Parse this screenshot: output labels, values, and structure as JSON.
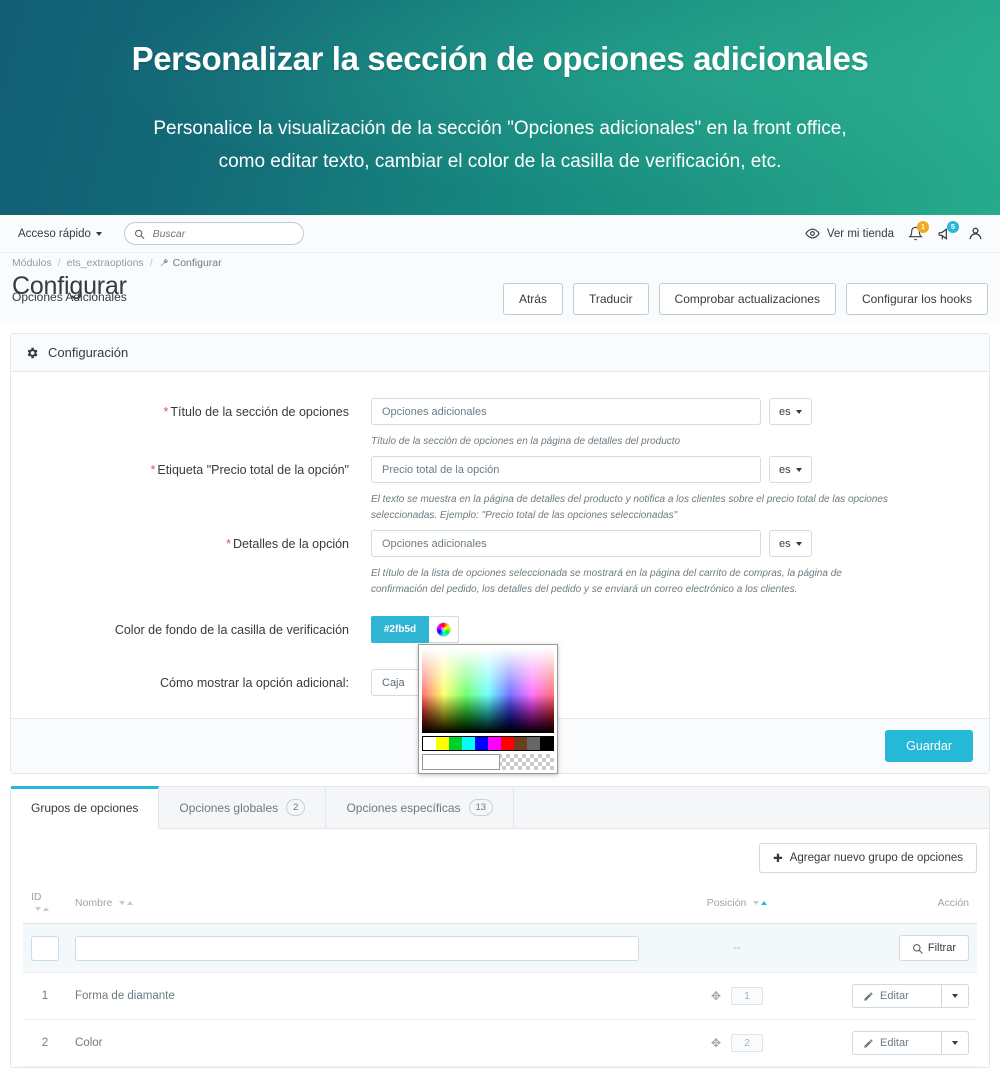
{
  "hero": {
    "title": "Personalizar la sección de opciones adicionales",
    "subtitle_line1": "Personalice la visualización de la sección \"Opciones adicionales\" en la front office,",
    "subtitle_line2": "como editar texto, cambiar el color de la casilla de verificación, etc."
  },
  "topbar": {
    "quick_access": "Acceso rápido",
    "search_placeholder": "Buscar",
    "search_value": "",
    "view_shop": "Ver mi tienda",
    "notifications_badge": "1",
    "announcements_badge": "5"
  },
  "breadcrumb": {
    "item1": "Módulos",
    "sep": "/",
    "item2": "ets_extraoptions",
    "current": "Configurar"
  },
  "page": {
    "title": "Configurar",
    "subtitle": "Opciones Adicionales"
  },
  "head_actions": {
    "back": "Atrás",
    "translate": "Traducir",
    "check_updates": "Comprobar actualizaciones",
    "configure_hooks": "Configurar los hooks"
  },
  "config_card": {
    "header": "Configuración",
    "save": "Guardar",
    "fields": [
      {
        "label": "Título de la sección de opciones",
        "required": true,
        "value": "Opciones adicionales",
        "lang": "es",
        "help": "Título de la sección de opciones en la página de detalles del producto"
      },
      {
        "label": "Etiqueta \"Precio total de la opción\"",
        "required": true,
        "value": "Precio total de la opción",
        "lang": "es",
        "help": "El texto se muestra en la página de detalles del producto y notifica a los clientes sobre el precio total de las opciones seleccionadas. Ejemplo: \"Precio total de las opciones seleccionadas\""
      },
      {
        "label": "Detalles de la opción",
        "required": true,
        "value": "Opciones adicionales",
        "lang": "es",
        "help": "El título de la lista de opciones seleccionada se mostrará en la página del carrito de compras, la página de confirmación del pedido, los detalles del pedido y se enviará un correo electrónico a los clientes."
      }
    ],
    "color_field": {
      "label": "Color de fondo de la casilla de verificación",
      "value": "#2fb5d",
      "swatch_color": "#2fb5d4",
      "picker_value": ""
    },
    "display_field": {
      "label": "Cómo mostrar la opción adicional:",
      "value": "Caja"
    }
  },
  "tabs": [
    {
      "label": "Grupos de opciones",
      "count": "",
      "active": true
    },
    {
      "label": "Opciones globales",
      "count": "2",
      "active": false
    },
    {
      "label": "Opciones específicas",
      "count": "13",
      "active": false
    }
  ],
  "list": {
    "add_button": "Agregar nuevo grupo de opciones",
    "filter_button": "Filtrar",
    "columns": {
      "id": "ID",
      "name": "Nombre",
      "position": "Posición",
      "action": "Acción"
    },
    "filter_values": {
      "id": "",
      "name": "",
      "position": "--"
    },
    "rows": [
      {
        "id": "1",
        "name": "Forma de diamante",
        "position": "1",
        "action": "Editar"
      },
      {
        "id": "2",
        "name": "Color",
        "position": "2",
        "action": "Editar"
      }
    ]
  },
  "colors": {
    "accent": "#25b9d7",
    "hero_from": "#125e74",
    "hero_to": "#27ab8c",
    "required": "#e2574c"
  }
}
